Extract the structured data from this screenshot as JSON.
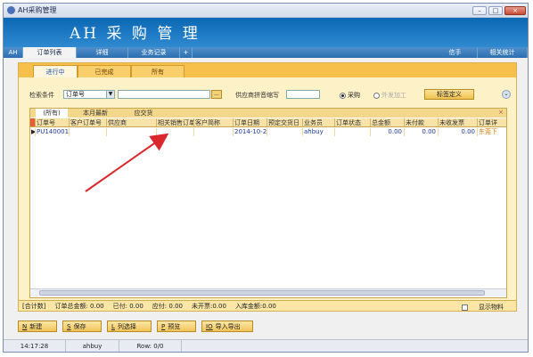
{
  "window": {
    "title": "AH采购管理"
  },
  "banner": {
    "app_title": "AH 采 购 管 理"
  },
  "nav": {
    "tabs": [
      {
        "label": "AH"
      },
      {
        "label": "订单列表"
      },
      {
        "label": "详细"
      },
      {
        "label": "业务记录"
      },
      {
        "label": "+"
      }
    ],
    "right": [
      {
        "label": "信手"
      },
      {
        "label": "相关统计"
      }
    ]
  },
  "subtabs": [
    {
      "label": "进行中"
    },
    {
      "label": "已完成"
    },
    {
      "label": "所有"
    }
  ],
  "search": {
    "condition_label": "检索条件",
    "condition_value": "订单号",
    "browse_label": "...",
    "supplier_label": "供应商拼音缩写",
    "radio_purchase": "采购",
    "radio_external": "外发加工",
    "custom_button": "标签定义",
    "expand_icon": "chevron-down-icon"
  },
  "grid": {
    "tabs": [
      {
        "label": "(所有)"
      },
      {
        "label": "本月最新"
      },
      {
        "label": "应交货"
      }
    ],
    "close": "×",
    "columns": [
      "",
      "订单号",
      "客户订单号",
      "供应商",
      "相关销售订单",
      "客户简称",
      "订单日期",
      "预定交货日",
      "业务员",
      "订单状态",
      "总金额",
      "未付款",
      "未收发票",
      "订单详"
    ],
    "rows": [
      {
        "pointer": "▶",
        "order_no": "PU140001",
        "customer_order": "",
        "supplier": "",
        "sales_order": "",
        "customer": "",
        "date": "2014-10-2",
        "due": "",
        "staff": "ahbuy",
        "status": "",
        "total": "0.00",
        "unpaid": "0.00",
        "uninvoiced": "0.00",
        "detail": "东莞下"
      }
    ]
  },
  "summary": {
    "total_label": "[合计数]",
    "order_total": "订单总金额: 0.00",
    "paid": "已付: 0.00",
    "payable": "应付: 0.00",
    "uninvoiced": "未开票:0.00",
    "stock_in": "入库金额:0.00",
    "show_material": "显示物料"
  },
  "toolbar": [
    {
      "key": "N",
      "label": "新建"
    },
    {
      "key": "S",
      "label": "保存"
    },
    {
      "key": "L",
      "label": "列选择"
    },
    {
      "key": "P",
      "label": "预览"
    },
    {
      "key": "IO",
      "label": "导入导出"
    }
  ],
  "status": {
    "time": "14:17:28",
    "user": "ahbuy",
    "row": "Row: 0/0"
  },
  "colors": {
    "banner": "#1a76c2",
    "accent_yellow": "#f6c04a",
    "arrow": "#d9272d"
  }
}
